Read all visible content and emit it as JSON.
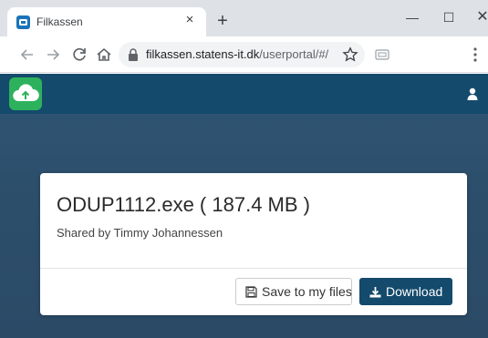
{
  "browser": {
    "tab": {
      "title": "Filkassen",
      "close_glyph": "×"
    },
    "new_tab_glyph": "+",
    "window": {
      "minimize_glyph": "—",
      "maximize_glyph": "☐",
      "close_glyph": "✕"
    },
    "address": {
      "host": "filkassen.statens-it.dk",
      "path": "/userportal/#/s..."
    },
    "icons": {
      "favicon": "filkassen-favicon-icon",
      "back": "arrow-left-icon",
      "forward": "arrow-right-icon",
      "reload": "reload-icon",
      "home": "home-icon",
      "lock": "lock-icon",
      "bookmark": "star-icon",
      "extension": "extension-icon",
      "menu": "kebab-menu-icon"
    }
  },
  "app": {
    "colors": {
      "header": "#144a6c",
      "logo": "#2eb15d",
      "primary_button": "#144a6c"
    },
    "logo_icon": "cloud-upload-icon",
    "user_icon": "user-icon"
  },
  "share": {
    "file_title": "ODUP1112.exe ( 187.4 MB )",
    "shared_by": "Shared by Timmy Johannessen",
    "save_label": "Save to my files",
    "download_label": "Download",
    "save_icon": "floppy-disk-icon",
    "download_icon": "download-icon"
  }
}
